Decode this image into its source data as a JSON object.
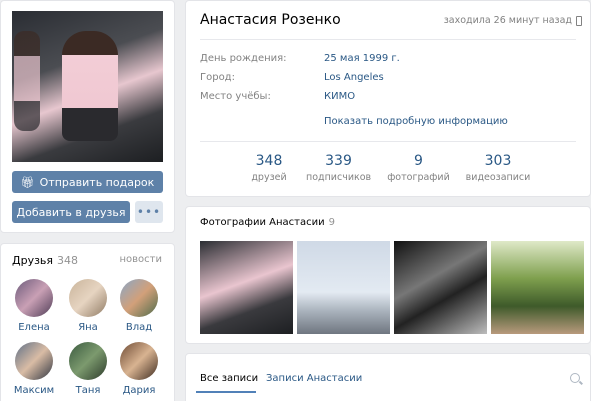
{
  "profile": {
    "name": "Анастасия Розенко",
    "last_seen": "заходила 26 минут назад",
    "info": [
      {
        "label": "День рождения:",
        "value": "25 мая 1999 г."
      },
      {
        "label": "Город:",
        "value": "Los Angeles"
      },
      {
        "label": "Место учёбы:",
        "value": "КИМО"
      }
    ],
    "more_info": "Показать подробную информацию",
    "counters": [
      {
        "num": "348",
        "label": "друзей"
      },
      {
        "num": "339",
        "label": "подписчиков"
      },
      {
        "num": "9",
        "label": "фотографий"
      },
      {
        "num": "303",
        "label": "видеозаписи"
      }
    ]
  },
  "actions": {
    "gift": "Отправить подарок",
    "add_friend": "Добавить в друзья",
    "more": "•••"
  },
  "friends": {
    "title": "Друзья",
    "count": "348",
    "news": "новости",
    "items": [
      "Елена",
      "Яна",
      "Влад",
      "Максим",
      "Таня",
      "Дария"
    ]
  },
  "photos": {
    "title": "Фотографии Анастасии",
    "count": "9"
  },
  "wall": {
    "tabs": [
      "Все записи",
      "Записи Анастасии"
    ]
  },
  "colors": {
    "accent": "#5e81a8",
    "link": "#2a5885",
    "background": "#edeef0"
  }
}
